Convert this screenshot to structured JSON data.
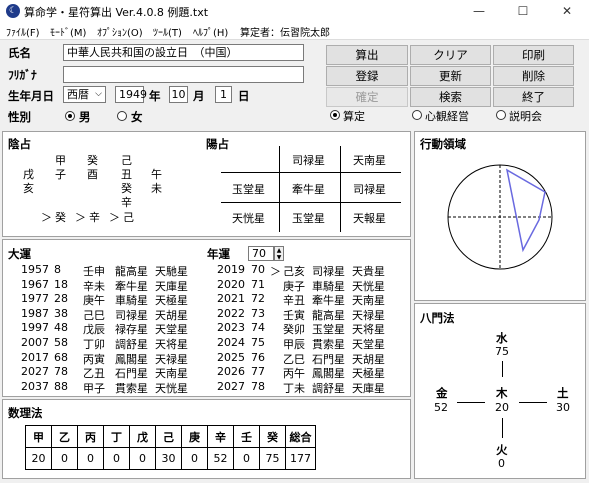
{
  "window": {
    "title": "算命学・星符算出 Ver.4.0.8 例題.txt",
    "minimize": "—",
    "maximize": "☐",
    "close": "✕"
  },
  "menu": [
    "ﾌｧｲﾙ(F)",
    "ﾓｰﾄﾞ(M)",
    "ｵﾌﾟｼｮﾝ(O)",
    "ﾂｰﾙ(T)",
    "ﾍﾙﾌﾟ(H)"
  ],
  "author": "算定者：伝習院太郎",
  "form": {
    "name_label": "氏名",
    "name_value": "中華人民共和国の設立日　（中国）",
    "kana_label": "ﾌﾘｶﾞﾅ",
    "kana_value": "",
    "birth_label": "生年月日",
    "era": "西暦",
    "year": "1949",
    "year_unit": "年",
    "month": "10",
    "month_unit": "月",
    "day": "1",
    "day_unit": "日",
    "gender_label": "性別",
    "male": "男",
    "female": "女"
  },
  "buttons": {
    "calc": "算出",
    "clear": "クリア",
    "print": "印刷",
    "register": "登録",
    "update": "更新",
    "delete": "削除",
    "confirm": "確定",
    "search": "検索",
    "exit": "終了"
  },
  "modes": {
    "m1": "算定",
    "m2": "心観経営",
    "m3": "説明会"
  },
  "inyo": {
    "title": "陰占",
    "row1": [
      "甲",
      "癸",
      "己",
      ""
    ],
    "row2": [
      "戌",
      "子",
      "酉",
      "丑",
      "午"
    ],
    "row3": [
      "亥",
      "",
      "",
      "癸",
      "未"
    ],
    "row4": [
      "辛"
    ],
    "row5": [
      "＞",
      "癸",
      "＞",
      "辛",
      "＞",
      "己"
    ]
  },
  "yosen": {
    "title": "陽占",
    "cells": [
      "司禄星",
      "天南星",
      "玉堂星",
      "牽牛星",
      "司禄星",
      "天恍星",
      "玉堂星",
      "天報星"
    ]
  },
  "kodo": {
    "title": "行動領域"
  },
  "taiun": {
    "title": "大運",
    "age_title": "年運",
    "age_value": "70",
    "left": [
      [
        "1957",
        "8",
        "壬申",
        "龍高星",
        "天馳星"
      ],
      [
        "1967",
        "18",
        "辛未",
        "牽牛星",
        "天庫星"
      ],
      [
        "1977",
        "28",
        "庚午",
        "車騎星",
        "天極星"
      ],
      [
        "1987",
        "38",
        "己巳",
        "司禄星",
        "天胡星"
      ],
      [
        "1997",
        "48",
        "戊辰",
        "禄存星",
        "天堂星"
      ],
      [
        "2007",
        "58",
        "丁卯",
        "調舒星",
        "天将星"
      ],
      [
        "2017",
        "68",
        "丙寅",
        "鳳閣星",
        "天禄星"
      ],
      [
        "2027",
        "78",
        "乙丑",
        "石門星",
        "天南星"
      ],
      [
        "2037",
        "88",
        "甲子",
        "貫索星",
        "天恍星"
      ]
    ],
    "right": [
      [
        "2019",
        "70",
        "＞",
        "己亥",
        "司禄星",
        "天貴星"
      ],
      [
        "2020",
        "71",
        "",
        "庚子",
        "車騎星",
        "天恍星"
      ],
      [
        "2021",
        "72",
        "",
        "辛丑",
        "牽牛星",
        "天南星"
      ],
      [
        "2022",
        "73",
        "",
        "壬寅",
        "龍高星",
        "天禄星"
      ],
      [
        "2023",
        "74",
        "",
        "癸卯",
        "玉堂星",
        "天将星"
      ],
      [
        "2024",
        "75",
        "",
        "甲辰",
        "貫索星",
        "天堂星"
      ],
      [
        "2025",
        "76",
        "",
        "乙巳",
        "石門星",
        "天胡星"
      ],
      [
        "2026",
        "77",
        "",
        "丙午",
        "鳳閣星",
        "天極星"
      ],
      [
        "2027",
        "78",
        "",
        "丁未",
        "調舒星",
        "天庫星"
      ]
    ]
  },
  "hachimon": {
    "title": "八門法",
    "north": "水",
    "north_v": "75",
    "west": "金",
    "west_v": "52",
    "center": "木",
    "center_v": "20",
    "east": "土",
    "east_v": "30",
    "south": "火",
    "south_v": "0"
  },
  "suri": {
    "title": "数理法",
    "headers": [
      "甲",
      "乙",
      "丙",
      "丁",
      "戊",
      "己",
      "庚",
      "辛",
      "壬",
      "癸",
      "総合"
    ],
    "values": [
      "20",
      "0",
      "0",
      "0",
      "0",
      "30",
      "0",
      "52",
      "0",
      "75",
      "177"
    ]
  }
}
